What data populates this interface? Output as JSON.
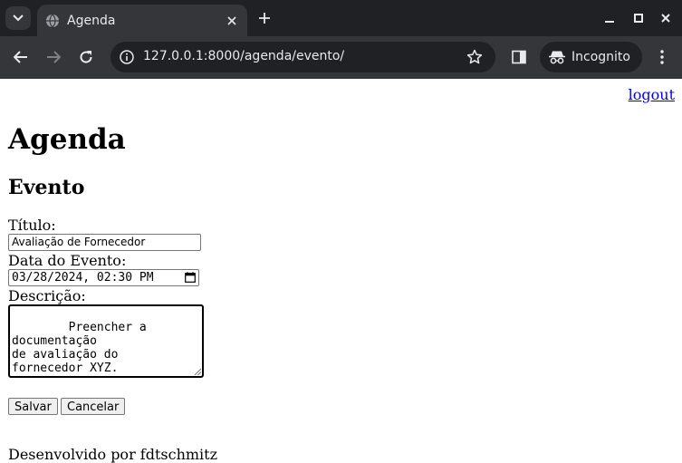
{
  "browser": {
    "tab_title": "Agenda",
    "url": "127.0.0.1:8000/agenda/evento/",
    "incognito_label": "Incognito"
  },
  "page": {
    "logout_link": "logout",
    "heading": "Agenda",
    "subheading": "Evento",
    "form": {
      "titulo_label": "Título:",
      "titulo_value": "Avaliação de Fornecedor",
      "data_label": "Data do Evento:",
      "data_value": "03/28/2024, 02:30 PM",
      "descricao_label": "Descrição:",
      "descricao_value": "Preencher a documentação\nde avaliação do\nfornecedor XYZ.",
      "save_button": "Salvar",
      "cancel_button": "Cancelar"
    },
    "footer": "Desenvolvido por fdtschmitz"
  }
}
